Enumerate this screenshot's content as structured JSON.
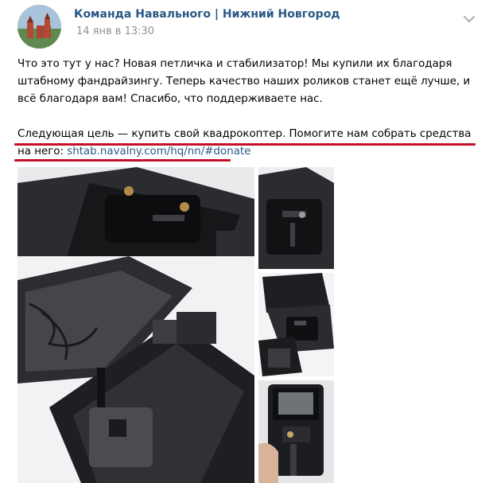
{
  "post": {
    "author": "Команда Навального | Нижний Новгород",
    "date": "14 янв в 13:30",
    "more_icon": "chevron-down-icon",
    "paragraph1": "Что это тут у нас? Новая петличка и стабилизатор! Мы купили их благодаря штабному фандрайзингу. Теперь качество наших роликов станет ещё лучше, и всё благодаря вам! Спасибо, что поддерживаете нас.",
    "paragraph2": "Следующая цель — купить свой квадрокоптер. Помогите нам собрать средства на него:",
    "link": "shtab.navalny.com/hq/nn/#donate",
    "highlight_color": "#c3102a",
    "link_color": "#2a5885",
    "photos": [
      {
        "name": "photo-gimbal-case"
      },
      {
        "name": "photo-microphone-case"
      },
      {
        "name": "photo-gimbal-case-top"
      },
      {
        "name": "photo-open-cases"
      },
      {
        "name": "photo-gimbal-in-hand"
      }
    ]
  }
}
